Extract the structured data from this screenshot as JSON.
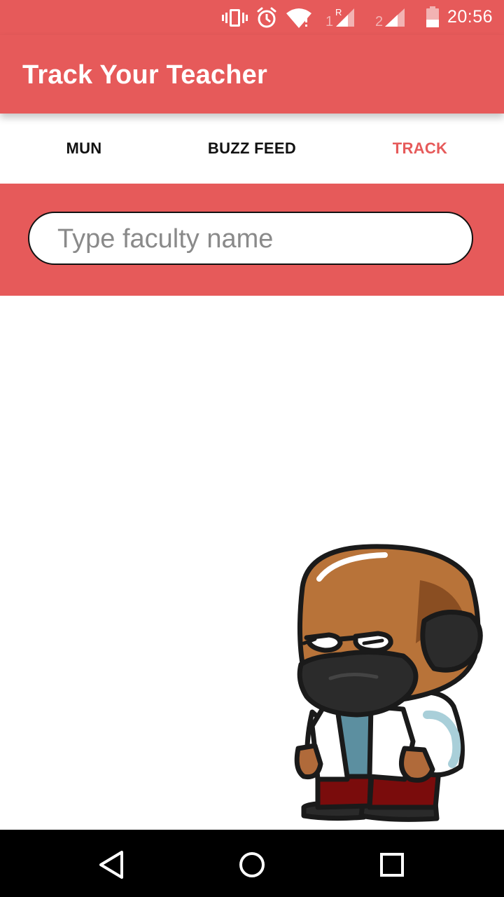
{
  "status_bar": {
    "time": "20:56",
    "sim1_label": "1",
    "sim1_roaming": "R",
    "sim2_label": "2",
    "icons": [
      "vibrate-icon",
      "alarm-icon",
      "wifi-icon",
      "signal-sim1-icon",
      "signal-sim2-icon",
      "battery-icon"
    ]
  },
  "app_bar": {
    "title": "Track Your Teacher"
  },
  "tabs": [
    {
      "label": "MUN",
      "active": false
    },
    {
      "label": "BUZZ FEED",
      "active": false
    },
    {
      "label": "TRACK",
      "active": true
    }
  ],
  "search": {
    "placeholder": "Type faculty name",
    "value": ""
  },
  "illustration": {
    "name": "teacher-character"
  },
  "nav_bar": {
    "icons": [
      "back-icon",
      "home-icon",
      "recents-icon"
    ]
  },
  "colors": {
    "primary": "#e65a5a",
    "active_tab": "#e65a5a",
    "tab_text": "#111111",
    "nav_bar": "#000000"
  }
}
